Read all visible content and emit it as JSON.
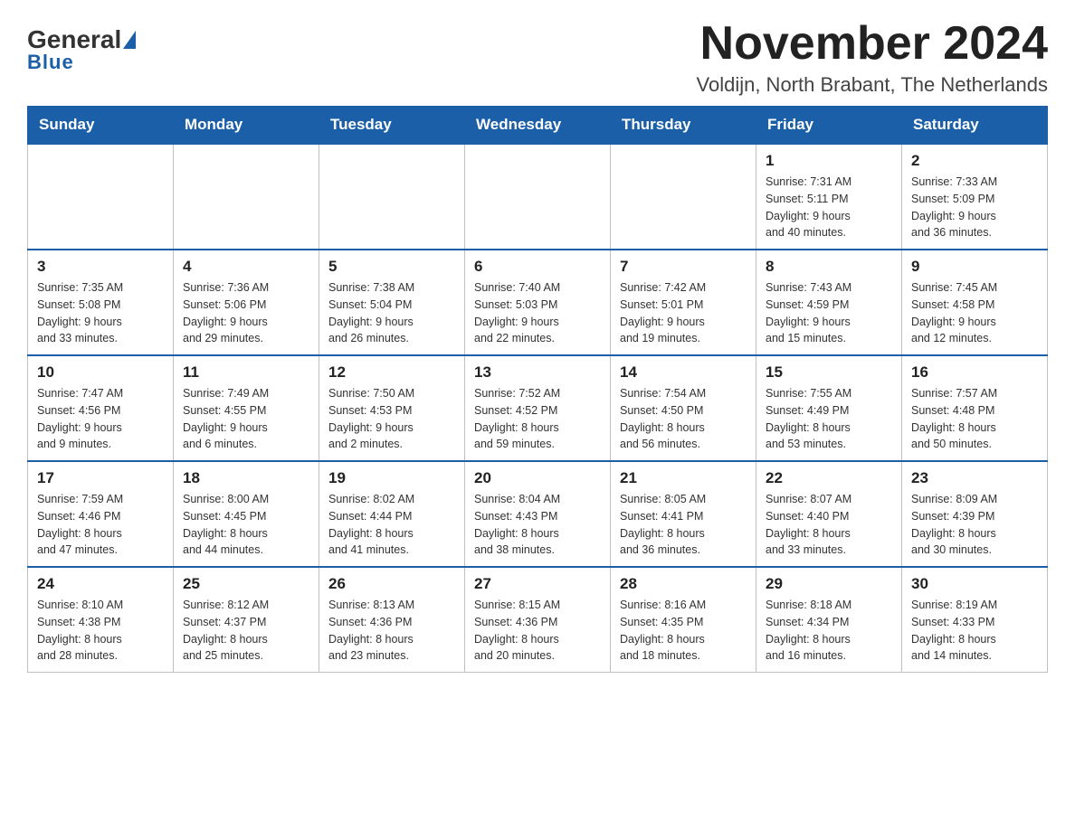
{
  "logo": {
    "general": "General",
    "blue": "Blue"
  },
  "header": {
    "month_title": "November 2024",
    "location": "Voldijn, North Brabant, The Netherlands"
  },
  "weekdays": [
    "Sunday",
    "Monday",
    "Tuesday",
    "Wednesday",
    "Thursday",
    "Friday",
    "Saturday"
  ],
  "weeks": [
    [
      {
        "day": "",
        "info": ""
      },
      {
        "day": "",
        "info": ""
      },
      {
        "day": "",
        "info": ""
      },
      {
        "day": "",
        "info": ""
      },
      {
        "day": "",
        "info": ""
      },
      {
        "day": "1",
        "info": "Sunrise: 7:31 AM\nSunset: 5:11 PM\nDaylight: 9 hours\nand 40 minutes."
      },
      {
        "day": "2",
        "info": "Sunrise: 7:33 AM\nSunset: 5:09 PM\nDaylight: 9 hours\nand 36 minutes."
      }
    ],
    [
      {
        "day": "3",
        "info": "Sunrise: 7:35 AM\nSunset: 5:08 PM\nDaylight: 9 hours\nand 33 minutes."
      },
      {
        "day": "4",
        "info": "Sunrise: 7:36 AM\nSunset: 5:06 PM\nDaylight: 9 hours\nand 29 minutes."
      },
      {
        "day": "5",
        "info": "Sunrise: 7:38 AM\nSunset: 5:04 PM\nDaylight: 9 hours\nand 26 minutes."
      },
      {
        "day": "6",
        "info": "Sunrise: 7:40 AM\nSunset: 5:03 PM\nDaylight: 9 hours\nand 22 minutes."
      },
      {
        "day": "7",
        "info": "Sunrise: 7:42 AM\nSunset: 5:01 PM\nDaylight: 9 hours\nand 19 minutes."
      },
      {
        "day": "8",
        "info": "Sunrise: 7:43 AM\nSunset: 4:59 PM\nDaylight: 9 hours\nand 15 minutes."
      },
      {
        "day": "9",
        "info": "Sunrise: 7:45 AM\nSunset: 4:58 PM\nDaylight: 9 hours\nand 12 minutes."
      }
    ],
    [
      {
        "day": "10",
        "info": "Sunrise: 7:47 AM\nSunset: 4:56 PM\nDaylight: 9 hours\nand 9 minutes."
      },
      {
        "day": "11",
        "info": "Sunrise: 7:49 AM\nSunset: 4:55 PM\nDaylight: 9 hours\nand 6 minutes."
      },
      {
        "day": "12",
        "info": "Sunrise: 7:50 AM\nSunset: 4:53 PM\nDaylight: 9 hours\nand 2 minutes."
      },
      {
        "day": "13",
        "info": "Sunrise: 7:52 AM\nSunset: 4:52 PM\nDaylight: 8 hours\nand 59 minutes."
      },
      {
        "day": "14",
        "info": "Sunrise: 7:54 AM\nSunset: 4:50 PM\nDaylight: 8 hours\nand 56 minutes."
      },
      {
        "day": "15",
        "info": "Sunrise: 7:55 AM\nSunset: 4:49 PM\nDaylight: 8 hours\nand 53 minutes."
      },
      {
        "day": "16",
        "info": "Sunrise: 7:57 AM\nSunset: 4:48 PM\nDaylight: 8 hours\nand 50 minutes."
      }
    ],
    [
      {
        "day": "17",
        "info": "Sunrise: 7:59 AM\nSunset: 4:46 PM\nDaylight: 8 hours\nand 47 minutes."
      },
      {
        "day": "18",
        "info": "Sunrise: 8:00 AM\nSunset: 4:45 PM\nDaylight: 8 hours\nand 44 minutes."
      },
      {
        "day": "19",
        "info": "Sunrise: 8:02 AM\nSunset: 4:44 PM\nDaylight: 8 hours\nand 41 minutes."
      },
      {
        "day": "20",
        "info": "Sunrise: 8:04 AM\nSunset: 4:43 PM\nDaylight: 8 hours\nand 38 minutes."
      },
      {
        "day": "21",
        "info": "Sunrise: 8:05 AM\nSunset: 4:41 PM\nDaylight: 8 hours\nand 36 minutes."
      },
      {
        "day": "22",
        "info": "Sunrise: 8:07 AM\nSunset: 4:40 PM\nDaylight: 8 hours\nand 33 minutes."
      },
      {
        "day": "23",
        "info": "Sunrise: 8:09 AM\nSunset: 4:39 PM\nDaylight: 8 hours\nand 30 minutes."
      }
    ],
    [
      {
        "day": "24",
        "info": "Sunrise: 8:10 AM\nSunset: 4:38 PM\nDaylight: 8 hours\nand 28 minutes."
      },
      {
        "day": "25",
        "info": "Sunrise: 8:12 AM\nSunset: 4:37 PM\nDaylight: 8 hours\nand 25 minutes."
      },
      {
        "day": "26",
        "info": "Sunrise: 8:13 AM\nSunset: 4:36 PM\nDaylight: 8 hours\nand 23 minutes."
      },
      {
        "day": "27",
        "info": "Sunrise: 8:15 AM\nSunset: 4:36 PM\nDaylight: 8 hours\nand 20 minutes."
      },
      {
        "day": "28",
        "info": "Sunrise: 8:16 AM\nSunset: 4:35 PM\nDaylight: 8 hours\nand 18 minutes."
      },
      {
        "day": "29",
        "info": "Sunrise: 8:18 AM\nSunset: 4:34 PM\nDaylight: 8 hours\nand 16 minutes."
      },
      {
        "day": "30",
        "info": "Sunrise: 8:19 AM\nSunset: 4:33 PM\nDaylight: 8 hours\nand 14 minutes."
      }
    ]
  ]
}
